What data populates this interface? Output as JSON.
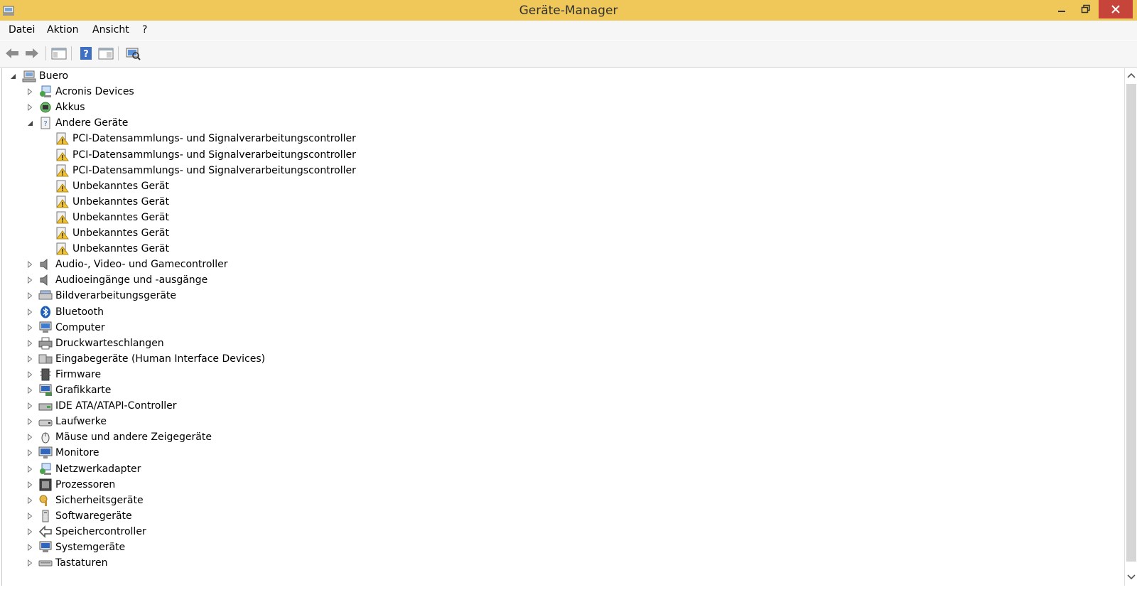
{
  "window": {
    "title": "Geräte-Manager"
  },
  "menu": [
    "Datei",
    "Aktion",
    "Ansicht",
    "?"
  ],
  "toolbar": {
    "buttons": [
      "back-icon",
      "forward-icon",
      "show-hide-console-tree-icon",
      "help-icon",
      "properties-icon",
      "scan-hardware-icon"
    ]
  },
  "tree": {
    "root": "Buero",
    "items": [
      {
        "label": "Acronis Devices",
        "icon": "network-adapter-icon",
        "expanded": false
      },
      {
        "label": "Akkus",
        "icon": "battery-icon",
        "expanded": false
      },
      {
        "label": "Andere Geräte",
        "icon": "unknown-device-category-icon",
        "expanded": true,
        "children": [
          "PCI-Datensammlungs- und Signalverarbeitungscontroller",
          "PCI-Datensammlungs- und Signalverarbeitungscontroller",
          "PCI-Datensammlungs- und Signalverarbeitungscontroller",
          "Unbekanntes Gerät",
          "Unbekanntes Gerät",
          "Unbekanntes Gerät",
          "Unbekanntes Gerät",
          "Unbekanntes Gerät"
        ]
      },
      {
        "label": "Audio-, Video- und Gamecontroller",
        "icon": "speaker-icon",
        "expanded": false
      },
      {
        "label": "Audioeingänge und -ausgänge",
        "icon": "speaker-icon",
        "expanded": false
      },
      {
        "label": "Bildverarbeitungsgeräte",
        "icon": "scanner-icon",
        "expanded": false
      },
      {
        "label": "Bluetooth",
        "icon": "bluetooth-icon",
        "expanded": false
      },
      {
        "label": "Computer",
        "icon": "computer-icon",
        "expanded": false
      },
      {
        "label": "Druckwarteschlangen",
        "icon": "printer-icon",
        "expanded": false
      },
      {
        "label": "Eingabegeräte (Human Interface Devices)",
        "icon": "hid-icon",
        "expanded": false
      },
      {
        "label": "Firmware",
        "icon": "firmware-icon",
        "expanded": false
      },
      {
        "label": "Grafikkarte",
        "icon": "display-adapter-icon",
        "expanded": false
      },
      {
        "label": "IDE ATA/ATAPI-Controller",
        "icon": "ide-controller-icon",
        "expanded": false
      },
      {
        "label": "Laufwerke",
        "icon": "disk-drive-icon",
        "expanded": false
      },
      {
        "label": "Mäuse und andere Zeigegeräte",
        "icon": "mouse-icon",
        "expanded": false
      },
      {
        "label": "Monitore",
        "icon": "monitor-icon",
        "expanded": false
      },
      {
        "label": "Netzwerkadapter",
        "icon": "network-adapter-icon",
        "expanded": false
      },
      {
        "label": "Prozessoren",
        "icon": "processor-icon",
        "expanded": false
      },
      {
        "label": "Sicherheitsgeräte",
        "icon": "security-key-icon",
        "expanded": false
      },
      {
        "label": "Softwaregeräte",
        "icon": "software-device-icon",
        "expanded": false
      },
      {
        "label": "Speichercontroller",
        "icon": "storage-controller-icon",
        "expanded": false
      },
      {
        "label": "Systemgeräte",
        "icon": "system-device-icon",
        "expanded": false
      },
      {
        "label": "Tastaturen",
        "icon": "keyboard-icon",
        "expanded": false
      }
    ]
  },
  "colors": {
    "titlebar": "#f0c85a",
    "close_button": "#c7443a",
    "menubar": "#f6f6f6"
  }
}
